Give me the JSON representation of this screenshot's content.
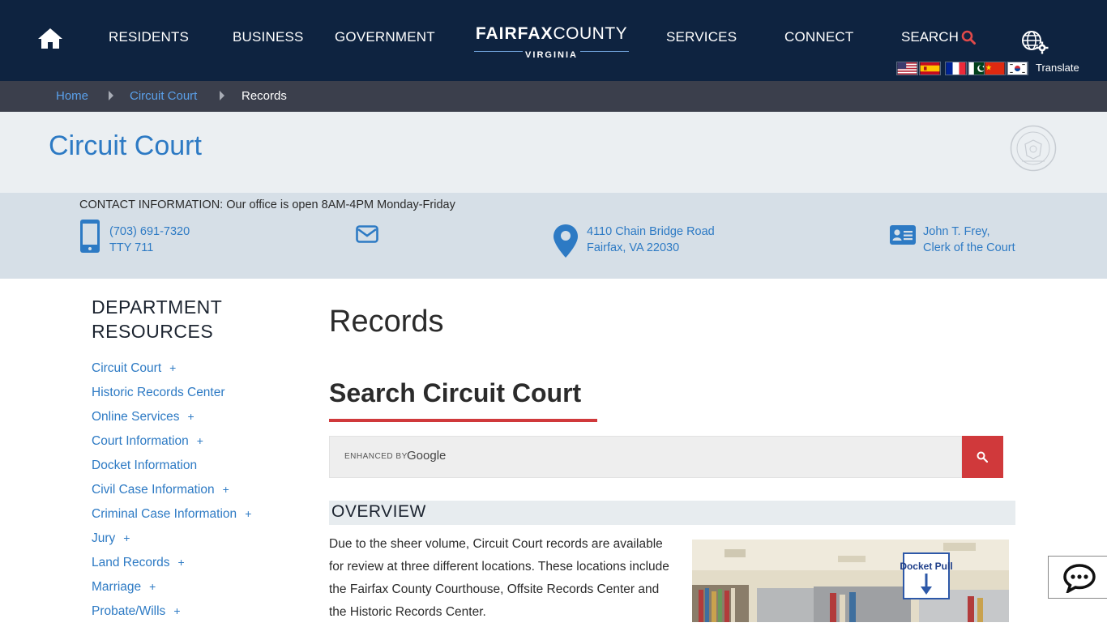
{
  "nav": {
    "items": [
      "RESIDENTS",
      "BUSINESS",
      "GOVERNMENT",
      "SERVICES",
      "CONNECT"
    ],
    "search_label": "SEARCH",
    "translate_label": "Translate",
    "logo_main_bold": "FAIRFAX",
    "logo_main_light": "COUNTY",
    "logo_sub": "VIRGINIA",
    "flags": [
      "english",
      "spanish",
      "french",
      "urdu",
      "chinese",
      "korean"
    ]
  },
  "breadcrumb": {
    "items": [
      "Home",
      "Circuit Court",
      "Records"
    ]
  },
  "department": {
    "title": "Circuit Court"
  },
  "contact": {
    "heading": "CONTACT INFORMATION: Our office is open 8AM-4PM Monday-Friday",
    "phone": "(703) 691-7320",
    "tty": "TTY 711",
    "address_line1": "4110 Chain Bridge Road",
    "address_line2": "Fairfax, VA 22030",
    "clerk_name": "John T. Frey,",
    "clerk_title": "Clerk of the Court"
  },
  "sidebar": {
    "title_line1": "DEPARTMENT",
    "title_line2": "RESOURCES",
    "items": [
      {
        "label": "Circuit Court",
        "expand": "+"
      },
      {
        "label": "Historic Records Center",
        "expand": ""
      },
      {
        "label": "Online Services",
        "expand": "+"
      },
      {
        "label": "Court Information",
        "expand": "+"
      },
      {
        "label": "Docket Information",
        "expand": ""
      },
      {
        "label": "Civil Case Information",
        "expand": "+"
      },
      {
        "label": "Criminal Case Information",
        "expand": "+"
      },
      {
        "label": "Jury",
        "expand": "+"
      },
      {
        "label": "Land Records",
        "expand": "+"
      },
      {
        "label": "Marriage",
        "expand": "+"
      },
      {
        "label": "Probate/Wills",
        "expand": "+"
      }
    ]
  },
  "main": {
    "page_title": "Records",
    "search_title": "Search Circuit Court",
    "search_enhanced": "ENHANCED BY",
    "search_google": "Google",
    "overview_heading": "OVERVIEW",
    "overview_text": "Due to the sheer volume, Circuit Court records are available for review at three different locations. These locations include the Fairfax County Courthouse, Offsite Records Center and the Historic Records Center.",
    "photo_sign": "Docket Pull"
  },
  "colors": {
    "nav_bg": "#0e2340",
    "breadcrumb_bg": "#3b3f4c",
    "link": "#2d7ac4",
    "accent_red": "#d0393b",
    "banner_bg": "#ebeff2",
    "contact_bg": "#d6dfe7"
  }
}
